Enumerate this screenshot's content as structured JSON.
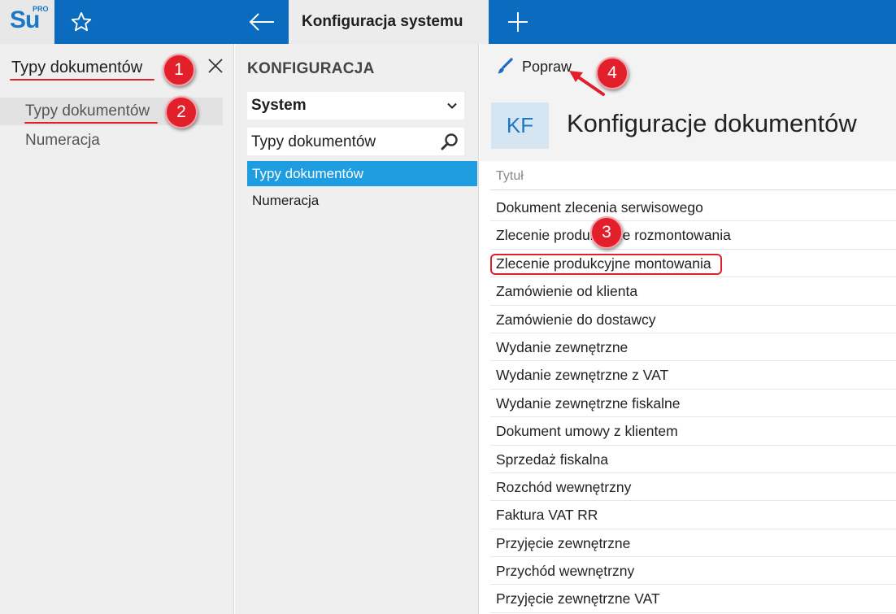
{
  "app": {
    "logo_text": "Su",
    "logo_badge": "PRO"
  },
  "topbar": {
    "active_tab": "Konfiguracja systemu"
  },
  "left": {
    "search_value": "Typy dokumentów",
    "items": [
      {
        "label": "Typy dokumentów"
      },
      {
        "label": "Numeracja"
      }
    ]
  },
  "middle": {
    "heading": "KONFIGURACJA",
    "select_value": "System",
    "search_value": "Typy dokumentów",
    "items": [
      {
        "label": "Typy dokumentów",
        "selected": true
      },
      {
        "label": "Numeracja",
        "selected": false
      }
    ]
  },
  "right": {
    "edit_label": "Popraw",
    "avatar_text": "KF",
    "title": "Konfiguracje dokumentów",
    "column_header": "Tytuł",
    "rows": [
      "Dokument zlecenia serwisowego",
      "Zlecenie produkcyjne rozmontowania",
      "Zlecenie produkcyjne montowania",
      "Zamówienie od klienta",
      "Zamówienie do dostawcy",
      "Wydanie zewnętrzne",
      "Wydanie zewnętrzne z VAT",
      "Wydanie zewnętrzne fiskalne",
      "Dokument umowy z klientem",
      "Sprzedaż fiskalna",
      "Rozchód wewnętrzny",
      "Faktura VAT RR",
      "Przyjęcie zewnętrzne",
      "Przychód wewnętrzny",
      "Przyjęcie zewnętrzne VAT"
    ]
  },
  "annotations": {
    "step1": "1",
    "step2": "2",
    "step3": "3",
    "step4": "4"
  },
  "colors": {
    "topbar": "#0a6bbf",
    "accent": "#1e9de1",
    "annotation": "#e2202c"
  }
}
